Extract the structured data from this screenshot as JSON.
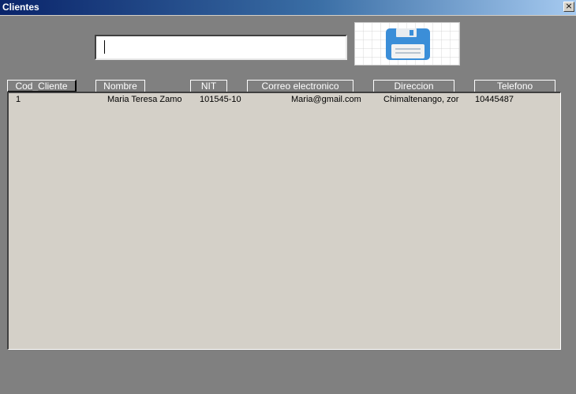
{
  "window": {
    "title": "Clientes",
    "close_glyph": "×"
  },
  "search": {
    "value": "",
    "placeholder": ""
  },
  "save_button": {
    "icon": "floppy-disk-icon",
    "accent_color": "#3b8ed8"
  },
  "table": {
    "columns": [
      "Cod_Cliente",
      "Nombre",
      "NIT",
      "Correo electronico",
      "Direccion",
      "Telefono"
    ],
    "rows": [
      [
        "1",
        "Maria Teresa Zamo",
        "101545-10",
        "Maria@gmail.com",
        "Chimaltenango, zor",
        "10445487"
      ]
    ]
  },
  "colors": {
    "background": "#808080",
    "list_background": "#d4d0c8",
    "titlebar_start": "#0a246a",
    "titlebar_end": "#a6caf0"
  }
}
